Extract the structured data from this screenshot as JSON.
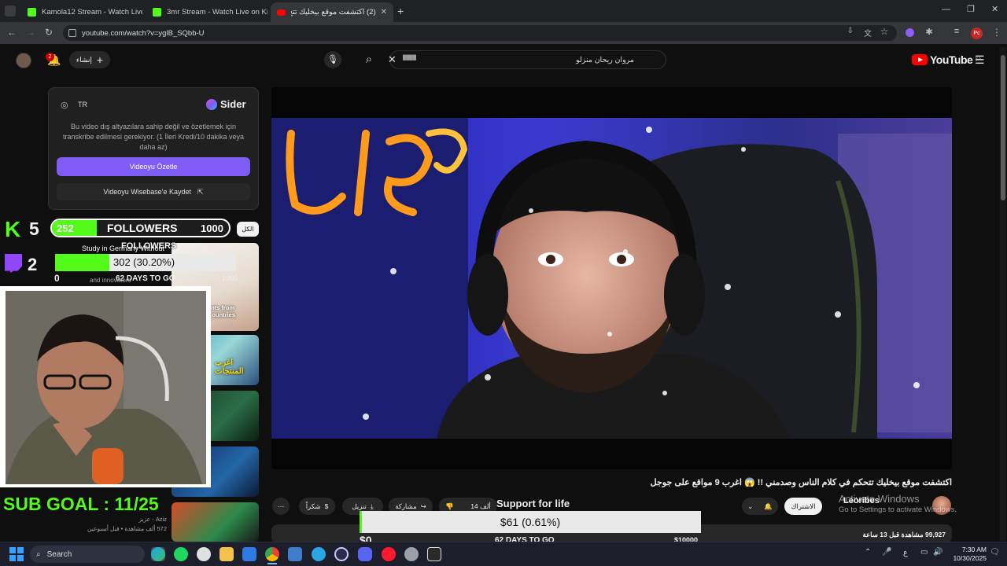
{
  "browser": {
    "tabs": [
      {
        "label": "Kamola12 Stream - Watch Live",
        "fav": "kick-logo-icon",
        "active": false
      },
      {
        "label": "3mr Stream - Watch Live on Kic",
        "fav": "kick-logo-icon",
        "active": false
      },
      {
        "label": "(2) اكتشفت موقع بيخليك تتح",
        "fav": "youtube-logo-icon",
        "active": true
      }
    ],
    "url": "youtube.com/watch?v=yglB_SQbb-U",
    "profile_initials": "Pc"
  },
  "youtube": {
    "logo_text": "YouTube",
    "country_code": "SA",
    "search_value": "مروان ريحان منزلو",
    "search_chip": "████",
    "create_label": "إنشاء",
    "notification_count": "2",
    "video_title": "اكتشفت موقع بيخليك تتحكم في كلام الناس وصدمني !! 😱 اغرب 9 مواقع على جوجل",
    "channel_name": "Leoribes",
    "subscribe_label": "الاشتراك",
    "likes_label": "14 ألف",
    "share_label": "مشاركة",
    "download_label": "تنزيل",
    "thanks_label": "شكراً",
    "views_text": "99,927 مشاهدة قبل 13 ساعة",
    "sidebar_video_meta": "572 ألف مشاهدة • قبل أسبوعين",
    "sidebar_video_channel": "عزيز - Aziz",
    "sidebar_filter": "الكل"
  },
  "sider": {
    "brand": "Sider",
    "language": "TR",
    "description": "Bu video dış altyazılara sahip değil ve özetlemek için transkribe edilmesi gerekiyor. (1 İleri Kredi/10 dakika veya daha az)",
    "summarize_label": "Videoyu Özetle",
    "save_label": "Videoyu Wisebase'e Kaydet"
  },
  "stream_overlay": {
    "kick_count": "5",
    "twitch_count": "2",
    "followers_current": "252",
    "followers_label": "FOLLOWERS",
    "followers_target": "1000",
    "followers_fraction": 0.252,
    "sub_text": "302 (30.20%)",
    "sub_fraction": 0.302,
    "sub_days": "62 DAYS TO GO",
    "sub_zero": "0",
    "sub_max": "1000",
    "followers_sub_label": "FOLLOWERS",
    "sub_goal": "SUB GOAL : 11/25",
    "thumb_text_1": "Study in Germany Without",
    "thumb_text_2": "and innovators",
    "thumb_text_3": "ents from Countries",
    "thumb_text_4": "اغرب المنتجات"
  },
  "support_bar": {
    "title": "Support for life",
    "amount_text": "$61 (0.61%)",
    "fraction": 0.0061,
    "min_label": "$0",
    "days": "62 DAYS TO GO",
    "max_label": "$10000"
  },
  "windows_watermark": {
    "line1": "Activate Windows",
    "line2": "Go to Settings to activate Windows."
  },
  "taskbar": {
    "search_label": "Search",
    "time": "7:30 AM",
    "date": "10/30/2025",
    "lang": "ع"
  },
  "colors": {
    "kick_green": "#53fc18",
    "twitch_purple": "#9146ff",
    "youtube_red": "#ff0000",
    "sider_purple": "#7f5cf6"
  }
}
